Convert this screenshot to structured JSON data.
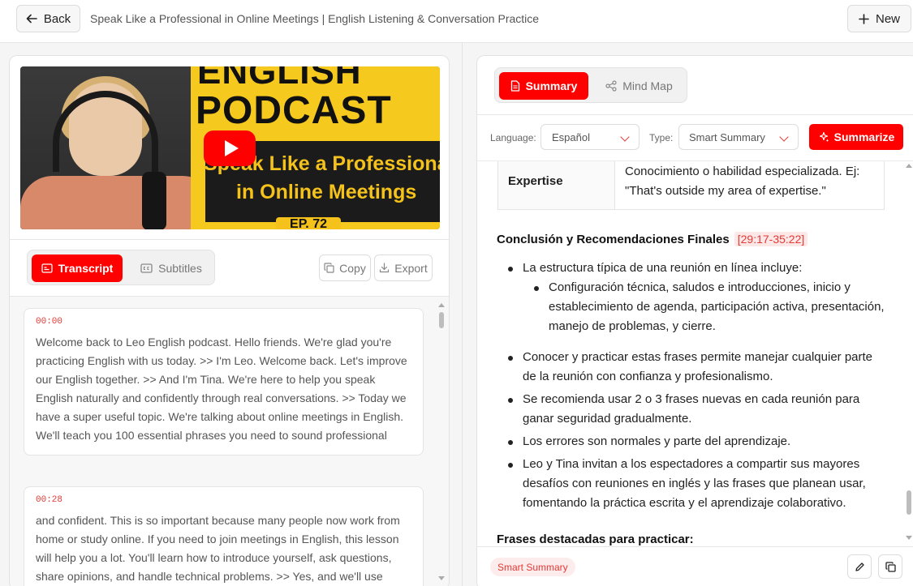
{
  "header": {
    "back_label": "Back",
    "title": "Speak Like a Professional in Online Meetings | English Listening & Conversation Practice",
    "new_label": "New"
  },
  "video": {
    "thumb_line1": "ENGLISH",
    "thumb_line2": "PODCAST",
    "thumb_line3": "Speak Like a Professional",
    "thumb_line4": "in Online Meetings",
    "thumb_line5": "EP. 72",
    "play_icon": "youtube-play-icon"
  },
  "left_tabs": {
    "transcript": "Transcript",
    "subtitles": "Subtitles",
    "copy": "Copy",
    "export": "Export"
  },
  "transcript": [
    {
      "time": "00:00",
      "text": "Welcome back to Leo English podcast.  Hello friends. We're glad you're practicing English with us today.  >> I'm Leo. Welcome back. Let's improve our  English together.  >> And I'm Tina. We're here to help you  speak English naturally and confidently  through real conversations.  >> Today we have a super useful topic.  We're talking about online meetings in English. We'll teach you 100 essential  phrases you need to sound professional"
    },
    {
      "time": "00:28",
      "text": "and confident. This is so important  because many people now work from home  or study online. If you need to join  meetings in English, this lesson will  help you a lot. You'll learn how to  introduce yourself, ask questions, share  opinions, and handle technical problems.  >> Yes, and we'll use"
    }
  ],
  "right_tabs": {
    "summary": "Summary",
    "mindmap": "Mind Map"
  },
  "controls": {
    "language_label": "Language:",
    "language_value": "Español",
    "type_label": "Type:",
    "type_value": "Smart Summary",
    "summarize_label": "Summarize"
  },
  "summary": {
    "glossary_term": "Expertise",
    "glossary_def": "Conocimiento o habilidad especializada. Ej: \"That's outside my area of expertise.\"",
    "section_title": "Conclusión y Recomendaciones Finales",
    "section_time": "[29:17-35:22]",
    "bullet1": "La estructura típica de una reunión en línea incluye:",
    "bullet1_sub": "Configuración técnica, saludos e introducciones, inicio y establecimiento de agenda, participación activa, presentación, manejo de problemas, y cierre.",
    "bullet2": "Conocer y practicar estas frases permite manejar cualquier parte de la reunión con confianza y profesionalismo.",
    "bullet3": "Se recomienda usar 2 o 3 frases nuevas en cada reunión para ganar seguridad gradualmente.",
    "bullet4": "Los errores son normales y parte del aprendizaje.",
    "bullet5": "Leo y Tina invitan a los espectadores a compartir sus mayores desafíos con reuniones en inglés y las frases que planean usar, fomentando la práctica escrita y el aprendizaje colaborativo.",
    "next_title": "Frases destacadas para practicar:"
  },
  "footer": {
    "badge": "Smart Summary"
  },
  "colors": {
    "accent": "#ff0000",
    "timestamp": "#e53935"
  }
}
